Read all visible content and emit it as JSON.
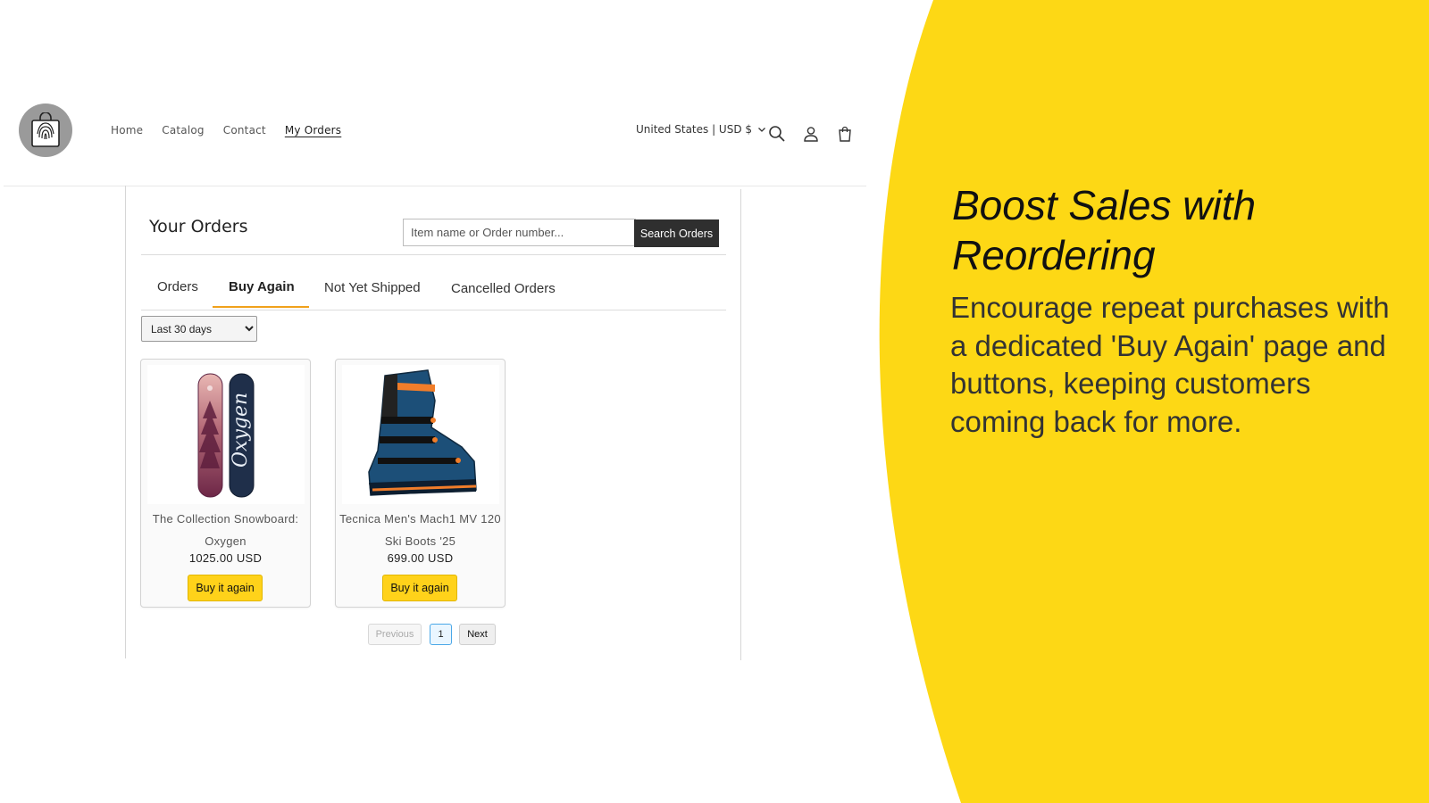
{
  "header": {
    "nav": [
      {
        "label": "Home",
        "active": false
      },
      {
        "label": "Catalog",
        "active": false
      },
      {
        "label": "Contact",
        "active": false
      },
      {
        "label": "My Orders",
        "active": true
      }
    ],
    "country_selector": "United States | USD $",
    "icons": [
      "search-icon",
      "account-icon",
      "cart-icon"
    ]
  },
  "orders": {
    "title": "Your Orders",
    "search_placeholder": "Item name or Order number...",
    "search_button": "Search Orders",
    "tabs": [
      {
        "label": "Orders",
        "active": false
      },
      {
        "label": "Buy Again",
        "active": true
      },
      {
        "label": "Not Yet Shipped",
        "active": false
      },
      {
        "label": "Cancelled Orders",
        "active": false
      }
    ],
    "period": "Last 30 days",
    "products": [
      {
        "name_line1": "The Collection Snowboard:",
        "name_line2": "Oxygen",
        "price": "1025.00 USD",
        "button": "Buy it again",
        "board_text": "Oxygen"
      },
      {
        "name_line1": "Tecnica Men's Mach1 MV 120",
        "name_line2": "Ski Boots '25",
        "price": "699.00 USD",
        "button": "Buy it again"
      }
    ],
    "pagination": {
      "previous": "Previous",
      "page": "1",
      "next": "Next"
    }
  },
  "marketing": {
    "headline": "Boost Sales with Reordering",
    "body": "Encourage repeat purchases with a dedicated 'Buy Again' page and buttons, keeping customers coming back for more.",
    "accent_color": "#fdd815"
  }
}
